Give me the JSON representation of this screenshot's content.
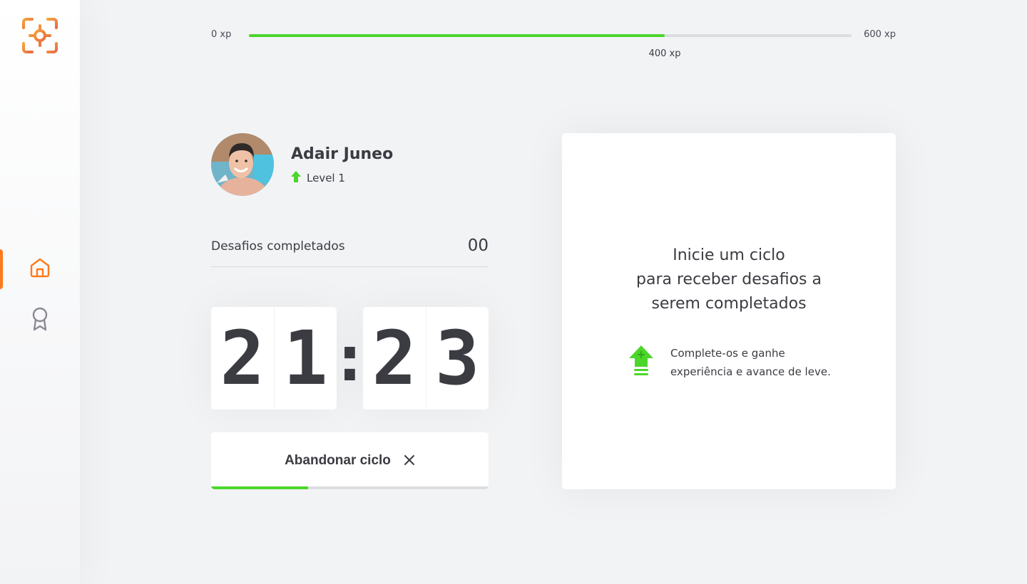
{
  "sidebar": {
    "logo": "target-logo",
    "items": [
      {
        "name": "home",
        "icon": "home-icon",
        "active": true
      },
      {
        "name": "awards",
        "icon": "award-icon",
        "active": false
      }
    ]
  },
  "xp": {
    "min_label": "0 xp",
    "max_label": "600 xp",
    "current_label": "400 xp",
    "current": 400,
    "max": 600,
    "progress_percent": 69
  },
  "profile": {
    "name": "Adair Juneo",
    "level_label": "Level 1",
    "avatar": "user-avatar-photo"
  },
  "completed": {
    "label": "Desafios completados",
    "count": "00"
  },
  "countdown": {
    "minutes": [
      "2",
      "1"
    ],
    "separator": ":",
    "seconds": [
      "2",
      "3"
    ]
  },
  "abandon_button": {
    "label": "Abandonar ciclo",
    "icon": "close-icon",
    "cycle_progress_percent": 35
  },
  "challenge_box": {
    "title_lines": [
      "Inicie um ciclo",
      "para receber desafios a",
      "serem completados"
    ],
    "hint_lines": [
      "Complete-os e ganhe",
      "experiência e avance de leve."
    ],
    "hint_icon": "level-up-icon"
  },
  "colors": {
    "accent_orange": "#ff7a1a",
    "green": "#4cd62b",
    "text": "#3b3b42",
    "background": "#f2f3f5"
  }
}
